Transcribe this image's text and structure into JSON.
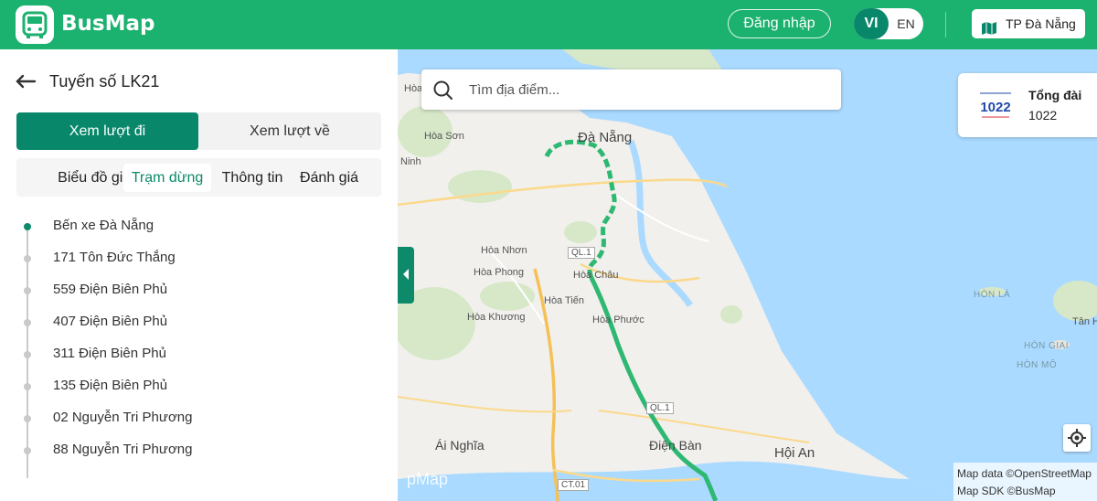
{
  "header": {
    "app_name": "BusMap",
    "login_label": "Đăng nhập",
    "lang_vi": "VI",
    "lang_en": "EN",
    "city_label": "TP Đà Nẵng",
    "brand_color": "#1bb16f",
    "accent_color": "#08876a"
  },
  "sidebar": {
    "route_title": "Tuyến số LK21",
    "direction": {
      "go_label": "Xem lượt đi",
      "back_label": "Xem lượt về",
      "selected": "go"
    },
    "tabs": [
      {
        "label": "Biểu đồ giờ",
        "active": false
      },
      {
        "label": "Trạm dừng",
        "active": true
      },
      {
        "label": "Thông tin",
        "active": false
      },
      {
        "label": "Đánh giá",
        "active": false
      }
    ],
    "stops": [
      "Bến xe Đà Nẵng",
      "171 Tôn Đức Thắng",
      "559 Điện Biên Phủ",
      "407 Điện Biên Phủ",
      "311 Điện Biên Phủ",
      "135 Điện Biên Phủ",
      "02 Nguyễn Tri Phương",
      "88 Nguyễn Tri Phương"
    ]
  },
  "map": {
    "search_placeholder": "Tìm địa điểm...",
    "hotline": {
      "title": "Tổng đài",
      "number": "1022",
      "logo_text": "1022"
    },
    "labels": {
      "hoa_s": "Hòa S",
      "hoa_son": "Hòa Sơn",
      "ninh": "Ninh",
      "da_nang": "Đà Nẵng",
      "hoa_nhon": "Hòa Nhơn",
      "hoa_phong": "Hòa Phong",
      "hoa_chau": "Hòa Châu",
      "hoa_tien": "Hòa Tiến",
      "hoa_khuong": "Hòa Khương",
      "hoa_phuoc": "Hòa Phước",
      "ql1_a": "QL.1",
      "ql1_b": "QL.1",
      "ai_nghia": "Ái Nghĩa",
      "dien_ban": "Điện Bàn",
      "hoi_an": "Hội An",
      "ct01": "CT.01",
      "hon_la": "HÒN LÁ",
      "tan_h": "Tân H",
      "hon_giai": "HÒN GIAI",
      "hon_mo": "HÒN MÔ",
      "watermark": "pMap"
    },
    "attribution": [
      "Map data ©OpenStreetMap",
      "Map SDK ©BusMap"
    ],
    "colors": {
      "water": "#aadaff",
      "route": "#2eb872"
    }
  }
}
